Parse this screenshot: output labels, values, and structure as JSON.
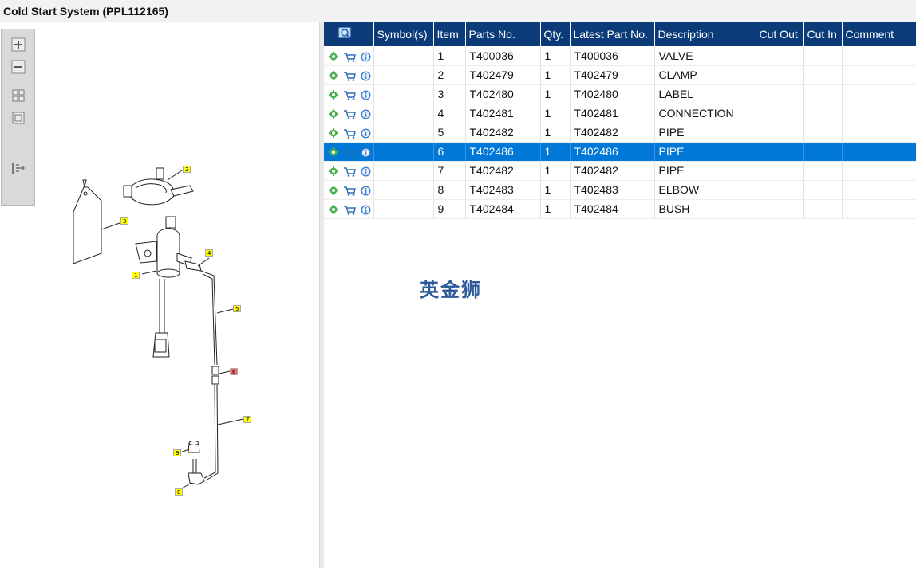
{
  "window": {
    "title": "Cold Start System (PPL112165)"
  },
  "toolbar": {
    "buttons": [
      {
        "name": "zoom-in",
        "icon": "plus-icon"
      },
      {
        "name": "zoom-out",
        "icon": "minus-icon"
      },
      {
        "name": "fit-all",
        "icon": "grid-icon"
      },
      {
        "name": "actual-size",
        "icon": "square-icon"
      },
      {
        "name": "toggle-panel",
        "icon": "panel-arrow-icon"
      }
    ]
  },
  "drawing": {
    "callouts": [
      "1",
      "2",
      "3",
      "4",
      "5",
      "6",
      "7",
      "8",
      "9"
    ],
    "highlighted_callout": "6"
  },
  "table": {
    "header_icon": "search-parts-icon",
    "columns": [
      "Symbol(s)",
      "Item",
      "Parts No.",
      "Qty.",
      "Latest Part No.",
      "Description",
      "Cut Out",
      "Cut In",
      "Comment"
    ],
    "rows": [
      {
        "symbols": "",
        "item": "1",
        "parts_no": "T400036",
        "qty": "1",
        "latest_part_no": "T400036",
        "description": "VALVE",
        "cut_out": "",
        "cut_in": "",
        "comment": ""
      },
      {
        "symbols": "",
        "item": "2",
        "parts_no": "T402479",
        "qty": "1",
        "latest_part_no": "T402479",
        "description": "CLAMP",
        "cut_out": "",
        "cut_in": "",
        "comment": ""
      },
      {
        "symbols": "",
        "item": "3",
        "parts_no": "T402480",
        "qty": "1",
        "latest_part_no": "T402480",
        "description": "LABEL",
        "cut_out": "",
        "cut_in": "",
        "comment": ""
      },
      {
        "symbols": "",
        "item": "4",
        "parts_no": "T402481",
        "qty": "1",
        "latest_part_no": "T402481",
        "description": "CONNECTION",
        "cut_out": "",
        "cut_in": "",
        "comment": ""
      },
      {
        "symbols": "",
        "item": "5",
        "parts_no": "T402482",
        "qty": "1",
        "latest_part_no": "T402482",
        "description": "PIPE",
        "cut_out": "",
        "cut_in": "",
        "comment": ""
      },
      {
        "symbols": "",
        "item": "6",
        "parts_no": "T402486",
        "qty": "1",
        "latest_part_no": "T402486",
        "description": "PIPE",
        "cut_out": "",
        "cut_in": "",
        "comment": ""
      },
      {
        "symbols": "",
        "item": "7",
        "parts_no": "T402482",
        "qty": "1",
        "latest_part_no": "T402482",
        "description": "PIPE",
        "cut_out": "",
        "cut_in": "",
        "comment": ""
      },
      {
        "symbols": "",
        "item": "8",
        "parts_no": "T402483",
        "qty": "1",
        "latest_part_no": "T402483",
        "description": "ELBOW",
        "cut_out": "",
        "cut_in": "",
        "comment": ""
      },
      {
        "symbols": "",
        "item": "9",
        "parts_no": "T402484",
        "qty": "1",
        "latest_part_no": "T402484",
        "description": "BUSH",
        "cut_out": "",
        "cut_in": "",
        "comment": ""
      }
    ],
    "selected_item": "6",
    "row_action_icons": [
      "gear-icon",
      "cart-icon",
      "info-icon"
    ]
  },
  "watermark": {
    "text": "英金狮"
  },
  "colors": {
    "header_bg": "#0b3b78",
    "selected_row": "#0078d7",
    "callout": "#ffff00",
    "callout_highlight": "#ff6464"
  }
}
